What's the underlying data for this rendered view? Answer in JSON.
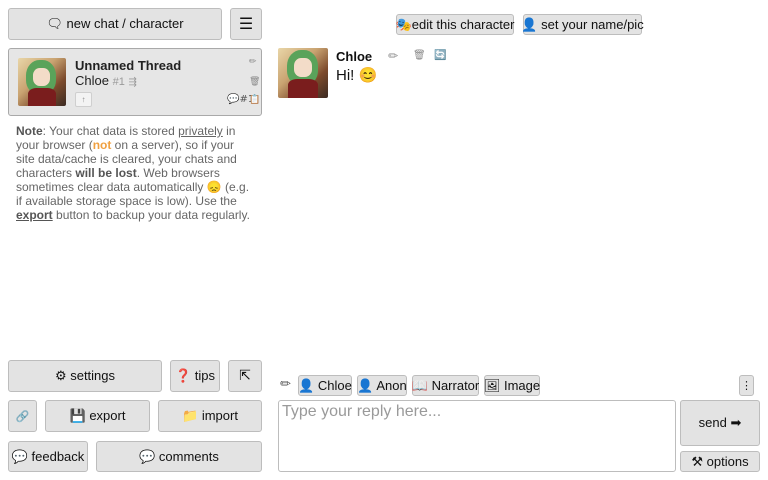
{
  "sidebar": {
    "new_chat_label": "🗨 new chat / character",
    "menu_icon": "☰",
    "thread": {
      "title": "Unnamed Thread",
      "character": "Chloe",
      "thread_num": "#1",
      "thread_icon": "⇶",
      "badge": "↑",
      "message_count": "💬#1",
      "action_icons": [
        "✏",
        "🗑",
        "📋"
      ]
    },
    "note": {
      "note_label": "Note",
      "t1": ": Your chat data is stored ",
      "privately": "privately",
      "t2": " in your browser (",
      "not": "not",
      "t3": " on a server), so if your site data/cache is cleared, your chats and characters ",
      "will_be_lost": "will be lost",
      "t4": ". Web browsers sometimes clear data automatically 😞 (e.g. if available storage space is low). Use the ",
      "export": "export",
      "t5": " button to backup your data regularly."
    },
    "buttons": {
      "settings": "⚙ settings",
      "tips": "❓ tips",
      "collapse": "⇱",
      "extra": "🔗",
      "export": "💾 export",
      "import": "📁 import",
      "feedback": "💬 feedback",
      "comments": "💬 comments"
    }
  },
  "header": {
    "edit_character": "🎭edit this character",
    "set_name": "👤 set your name/pic"
  },
  "message": {
    "author": "Chloe",
    "text": "Hi! 😊",
    "icons": [
      "✏",
      "🗑",
      "🔄"
    ]
  },
  "composer": {
    "pencil": "✏",
    "speakers": [
      "👤 Chloe",
      "👤 Anon",
      "📖 Narrator",
      "🖼 Image"
    ],
    "more": "⋮",
    "placeholder": "Type your reply here...",
    "send": "send ➡",
    "options": "⚒ options"
  },
  "colors": {
    "button_bg": "#e3e3e3",
    "card_bg": "#e6e6e6",
    "warn": "#f0a040"
  }
}
